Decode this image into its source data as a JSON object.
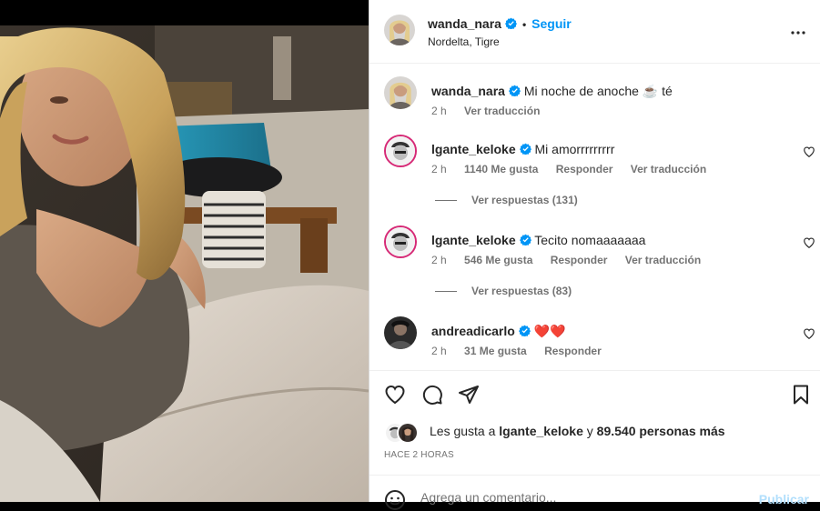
{
  "post": {
    "author": "wanda_nara",
    "follow_label": "Seguir",
    "location": "Nordelta, Tigre",
    "dot": "•"
  },
  "caption": {
    "username": "wanda_nara",
    "text": "Mi noche de anoche",
    "emoji": "☕",
    "suffix": "té",
    "time": "2 h",
    "translate_label": "Ver traducción"
  },
  "comments": [
    {
      "username": "lgante_keloke",
      "text": "Mi amorrrrrrrrr",
      "time": "2 h",
      "likes": "1140 Me gusta",
      "reply_label": "Responder",
      "translate_label": "Ver traducción",
      "replies_label": "Ver respuestas (131)"
    },
    {
      "username": "lgante_keloke",
      "text": "Tecito nomaaaaaaa",
      "time": "2 h",
      "likes": "546 Me gusta",
      "reply_label": "Responder",
      "translate_label": "Ver traducción",
      "replies_label": "Ver respuestas (83)"
    },
    {
      "username": "andreadicarlo",
      "text": "❤️❤️",
      "time": "2 h",
      "likes": "31 Me gusta",
      "reply_label": "Responder"
    }
  ],
  "likes": {
    "prefix": "Les gusta a",
    "user": "lgante_keloke",
    "connector": "y",
    "others": "89.540 personas más"
  },
  "time_ago": "HACE 2 HORAS",
  "comment_box": {
    "placeholder": "Agrega un comentario...",
    "publish_label": "Publicar"
  },
  "colors": {
    "accent": "#0095f6",
    "verified": "#0095f6",
    "muted": "#737373",
    "publish_disabled": "#b2dffc"
  },
  "icons": [
    "more-options-icon",
    "verified-icon",
    "heart-icon",
    "comment-icon",
    "share-icon",
    "bookmark-icon",
    "emoji-icon"
  ]
}
